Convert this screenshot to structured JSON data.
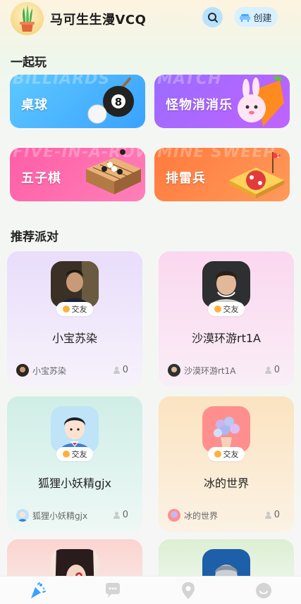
{
  "header": {
    "username": "马可生生漫VCQ",
    "create_label": "创建",
    "search_icon": "search-icon",
    "create_icon": "sofa-icon"
  },
  "sections": {
    "play_together": "一起玩",
    "recommended": "推荐派对"
  },
  "games": [
    {
      "label": "桌球",
      "bg_text": "BILLIARDS",
      "color": "#3aa2ff"
    },
    {
      "label": "怪物消消乐",
      "bg_text": "MATCH",
      "color": "#a66bff"
    },
    {
      "label": "五子棋",
      "bg_text": "FIVE-IN-A-ROW",
      "color": "#ff5ea6"
    },
    {
      "label": "排雷兵",
      "bg_text": "MINE SWEEP",
      "color": "#ff7a3d"
    }
  ],
  "parties": [
    {
      "name": "小宝苏染",
      "tag": "交友",
      "owner": "小宝苏染",
      "count": "0"
    },
    {
      "name": "沙漠环游rt1A",
      "tag": "交友",
      "owner": "沙漠环游rt1A",
      "count": "0"
    },
    {
      "name": "狐狸小妖精gjx",
      "tag": "交友",
      "owner": "狐狸小妖精gjx",
      "count": "0"
    },
    {
      "name": "冰的世界",
      "tag": "交友",
      "owner": "冰的世界",
      "count": "0"
    }
  ],
  "nav": [
    {
      "icon": "party-popper-icon",
      "active": true
    },
    {
      "icon": "chat-bubble-icon",
      "active": false
    },
    {
      "icon": "location-pin-icon",
      "active": false
    },
    {
      "icon": "smiley-icon",
      "active": false
    }
  ]
}
